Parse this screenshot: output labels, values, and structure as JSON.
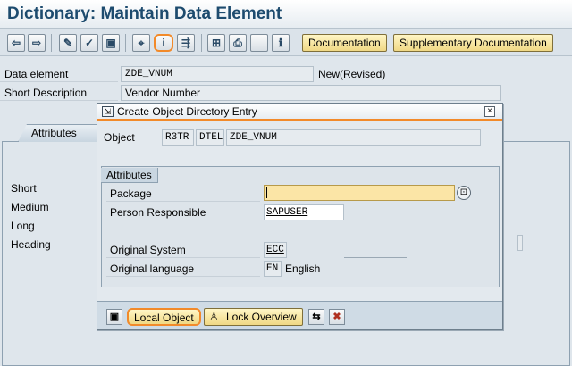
{
  "window": {
    "title": "Dictionary: Maintain Data Element"
  },
  "toolbar": {
    "icons": [
      "back-arrow-icon",
      "forward-arrow-icon",
      "display-change-icon",
      "activate-icon",
      "check-icon",
      "where-used-icon",
      "object-info-icon",
      "navigation-icon",
      "hierarchy-icon",
      "print-icon",
      "blank-icon",
      "info-icon"
    ],
    "documentation_label": "Documentation",
    "supplementary_label": "Supplementary Documentation"
  },
  "header": {
    "data_element_label": "Data element",
    "data_element_value": "ZDE_VNUM",
    "status": "New(Revised)",
    "short_description_label": "Short Description",
    "short_description_value": "Vendor Number"
  },
  "background": {
    "tab_label": "Attributes",
    "rows": [
      "Short",
      "Medium",
      "Long",
      "Heading"
    ]
  },
  "dialog": {
    "title": "Create Object Directory Entry",
    "object_label": "Object",
    "object_pgmid": "R3TR",
    "object_type": "DTEL",
    "object_name": "ZDE_VNUM",
    "attributes_title": "Attributes",
    "package_label": "Package",
    "package_value": "",
    "person_label": "Person Responsible",
    "person_value": "SAPUSER",
    "orig_system_label": "Original System",
    "orig_system_value": "ECC",
    "orig_language_label": "Original language",
    "orig_language_code": "EN",
    "orig_language_name": "English",
    "local_object_label": "Local Object",
    "lock_overview_label": "Lock Overview"
  },
  "colors": {
    "highlight": "#f28a2a",
    "title_text": "#1d4b6e",
    "required_field": "#fbe5a6"
  }
}
